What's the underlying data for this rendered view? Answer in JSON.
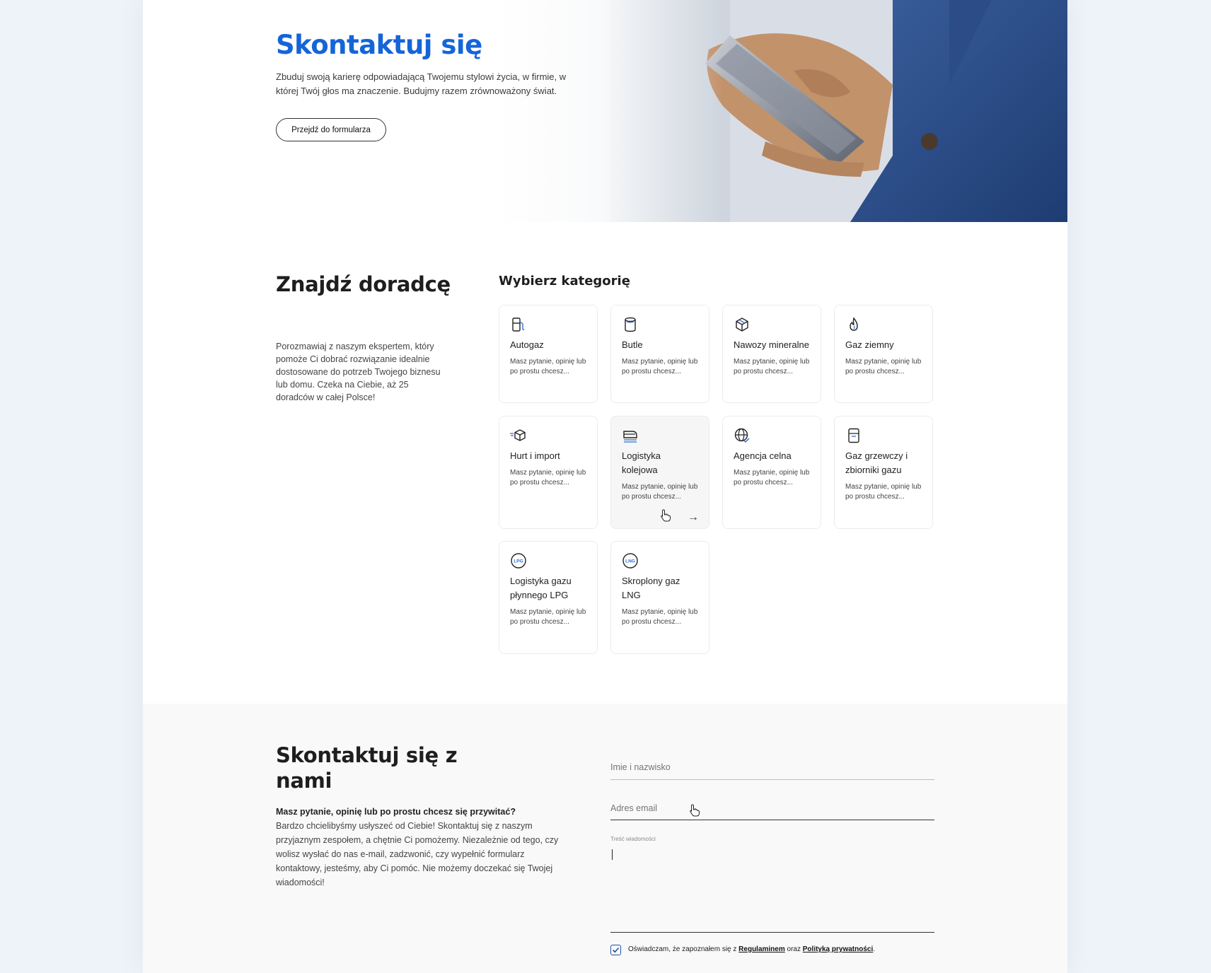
{
  "hero": {
    "title": "Skontaktuj się",
    "description": "Zbuduj swoją karierę odpowiadającą Twojemu stylowi życia, w firmie, w której Twój głos ma znaczenie. Budujmy razem zrównoważony świat.",
    "button_label": "Przejdź do formularza"
  },
  "advisor": {
    "title": "Znajdź doradcę",
    "description": "Porozmawiaj z naszym ekspertem, który pomoże Ci dobrać rozwiązanie idealnie dostosowane do potrzeb Twojego biznesu lub domu. Czeka na Ciebie, aż 25 doradców w całej Polsce!"
  },
  "categories": {
    "heading": "Wybierz kategorię",
    "items": [
      {
        "title": "Autogaz",
        "subtitle": "Masz pytanie, opinię lub po prostu chcesz...",
        "icon": "fuel-pump-icon"
      },
      {
        "title": "Butle",
        "subtitle": "Masz pytanie, opinię lub po prostu chcesz...",
        "icon": "gas-cylinder-icon"
      },
      {
        "title": "Nawozy mineralne",
        "subtitle": "Masz pytanie, opinię lub po prostu chcesz...",
        "icon": "cube-icon"
      },
      {
        "title": "Gaz ziemny",
        "subtitle": "Masz pytanie, opinię lub po prostu chcesz...",
        "icon": "flame-icon"
      },
      {
        "title": "Hurt i import",
        "subtitle": "Masz pytanie, opinię lub po prostu chcesz...",
        "icon": "fast-box-icon"
      },
      {
        "title": "Logistyka kolejowa",
        "subtitle": "Masz pytanie, opinię lub po prostu chcesz...",
        "icon": "train-icon",
        "arrow": "→"
      },
      {
        "title": "Agencja celna",
        "subtitle": "Masz pytanie, opinię lub po prostu chcesz...",
        "icon": "globe-check-icon"
      },
      {
        "title": "Gaz grzewczy i zbiorniki gazu",
        "subtitle": "Masz pytanie, opinię lub po prostu chcesz...",
        "icon": "gas-tank-icon"
      },
      {
        "title": "Logistyka gazu płynnego LPG",
        "subtitle": "Masz pytanie, opinię lub po prostu chcesz...",
        "icon": "lpg-badge-icon",
        "badge": "LPG"
      },
      {
        "title": "Skroplony gaz LNG",
        "subtitle": "Masz pytanie, opinię lub po prostu chcesz...",
        "icon": "lng-badge-icon",
        "badge": "LNG"
      }
    ]
  },
  "contact": {
    "title": "Skontaktuj się z nami",
    "lead": "Masz pytanie, opinię lub po prostu chcesz się przywitać?",
    "body": "Bardzo chcielibyśmy usłyszeć od Ciebie! Skontaktuj się z naszym przyjaznym zespołem, a chętnie Ci pomożemy. Niezależnie od tego, czy wolisz wysłać do nas e-mail, zadzwonić, czy wypełnić formularz kontaktowy, jesteśmy, aby Ci pomóc. Nie możemy doczekać się Twojej wiadomości!",
    "form": {
      "name_placeholder": "Imie i nazwisko",
      "email_placeholder": "Adres email",
      "message_label": "Treść wiadomości",
      "consent_prefix": "Oświadczam, że zapoznałem się z ",
      "consent_link1": "Regulaminem",
      "consent_middle": " oraz ",
      "consent_link2": "Polityką prywatności",
      "consent_suffix": ".",
      "consent_checked": true
    }
  },
  "colors": {
    "accent": "#1565d8",
    "page_bg": "#eef2f9",
    "icon_accent": "#2f6fd6"
  }
}
